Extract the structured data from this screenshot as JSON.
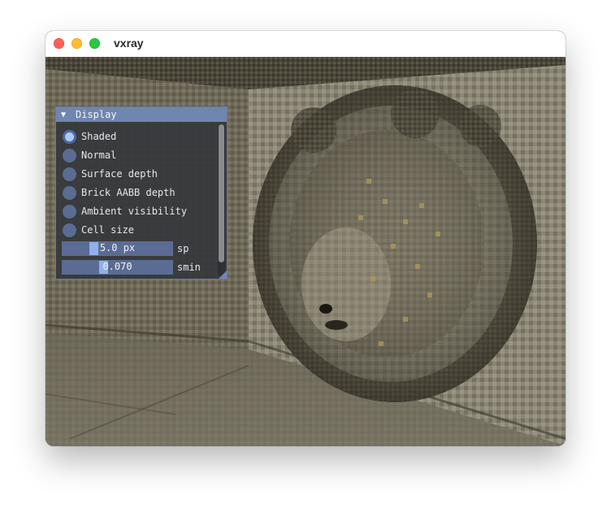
{
  "window": {
    "title": "vxray"
  },
  "panel": {
    "header_label": "Display",
    "modes": [
      {
        "label": "Shaded",
        "selected": true
      },
      {
        "label": "Normal",
        "selected": false
      },
      {
        "label": "Surface depth",
        "selected": false
      },
      {
        "label": "Brick AABB depth",
        "selected": false
      },
      {
        "label": "Ambient visibility",
        "selected": false
      },
      {
        "label": "Cell size",
        "selected": false
      }
    ],
    "sliders": [
      {
        "value": "5.0 px",
        "label": "sp"
      },
      {
        "value": "0.070",
        "label": "smin"
      }
    ]
  },
  "colors": {
    "panel_header": "#6f86b0",
    "radio": "#5a6c93",
    "slider_grab": "#8fb1ea",
    "close": "#ff5f57",
    "minimize": "#febc2e",
    "maximize": "#28c840"
  }
}
